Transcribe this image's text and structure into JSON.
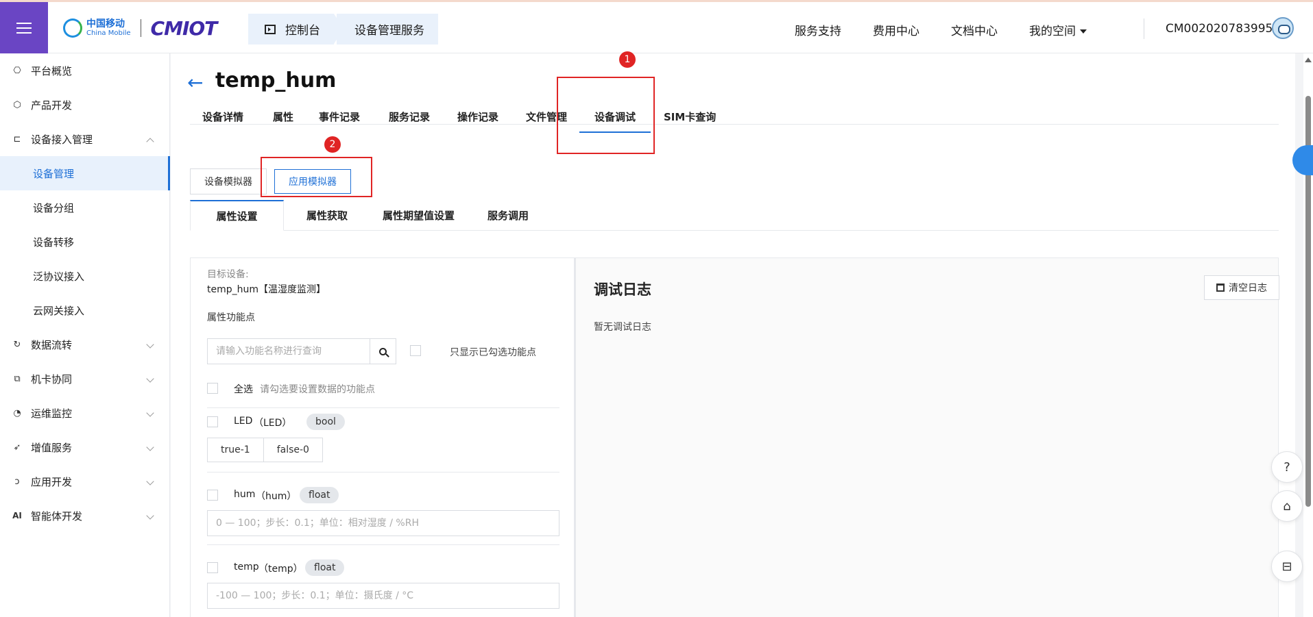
{
  "header": {
    "brand_cn": "中国移动",
    "brand_en": "China Mobile",
    "brand_mark": "CMIOT",
    "breadcrumbs": [
      "控制台",
      "设备管理服务"
    ],
    "nav": [
      "服务支持",
      "费用中心",
      "文档中心",
      "我的空间"
    ],
    "account": "CM002020783995"
  },
  "sidebar": {
    "items": [
      {
        "label": "平台概览",
        "icon": "dashboard-icon"
      },
      {
        "label": "产品开发",
        "icon": "cube-icon"
      },
      {
        "label": "设备接入管理",
        "icon": "device-access-icon"
      },
      {
        "label": "设备管理"
      },
      {
        "label": "设备分组"
      },
      {
        "label": "设备转移"
      },
      {
        "label": "泛协议接入"
      },
      {
        "label": "云网关接入"
      },
      {
        "label": "数据流转",
        "icon": "data-flow-icon"
      },
      {
        "label": "机卡协同",
        "icon": "sim-sync-icon"
      },
      {
        "label": "运维监控",
        "icon": "monitor-icon"
      },
      {
        "label": "增值服务",
        "icon": "send-icon"
      },
      {
        "label": "应用开发",
        "icon": "app-dev-icon"
      },
      {
        "label": "智能体开发",
        "icon": "ai-icon"
      }
    ]
  },
  "page": {
    "title": "temp_hum",
    "tabs": [
      "设备详情",
      "属性",
      "事件记录",
      "服务记录",
      "操作记录",
      "文件管理",
      "设备调试",
      "SIM卡查询"
    ],
    "active_tab": "设备调试",
    "simulators": [
      "设备模拟器",
      "应用模拟器"
    ],
    "active_simulator": "应用模拟器",
    "subtabs": [
      "属性设置",
      "属性获取",
      "属性期望值设置",
      "服务调用"
    ],
    "active_subtab": "属性设置"
  },
  "form": {
    "target_label": "目标设备:",
    "target_value": "temp_hum【温湿度监测】",
    "points_label": "属性功能点",
    "search_placeholder": "请输入功能名称进行查询",
    "only_checked": "只显示已勾选功能点",
    "select_all": "全选",
    "select_hint": "请勾选要设置数据的功能点",
    "properties": [
      {
        "name": "LED",
        "id": "（LED）",
        "type": "bool",
        "options": [
          "true-1",
          "false-0"
        ]
      },
      {
        "name": "hum",
        "id": "（hum）",
        "type": "float",
        "placeholder": "0 — 100；步长：0.1；单位：相对湿度 / %RH"
      },
      {
        "name": "temp",
        "id": "（temp）",
        "type": "float",
        "placeholder": "-100 — 100；步长：0.1；单位：摄氏度 / °C"
      }
    ]
  },
  "log": {
    "title": "调试日志",
    "empty": "暂无调试日志",
    "clear": "清空日志"
  },
  "annotations": [
    "1",
    "2"
  ],
  "colors": {
    "accent": "#1d6fd6",
    "menu_bg": "#6a45c4",
    "annotation_red": "#e02424"
  }
}
